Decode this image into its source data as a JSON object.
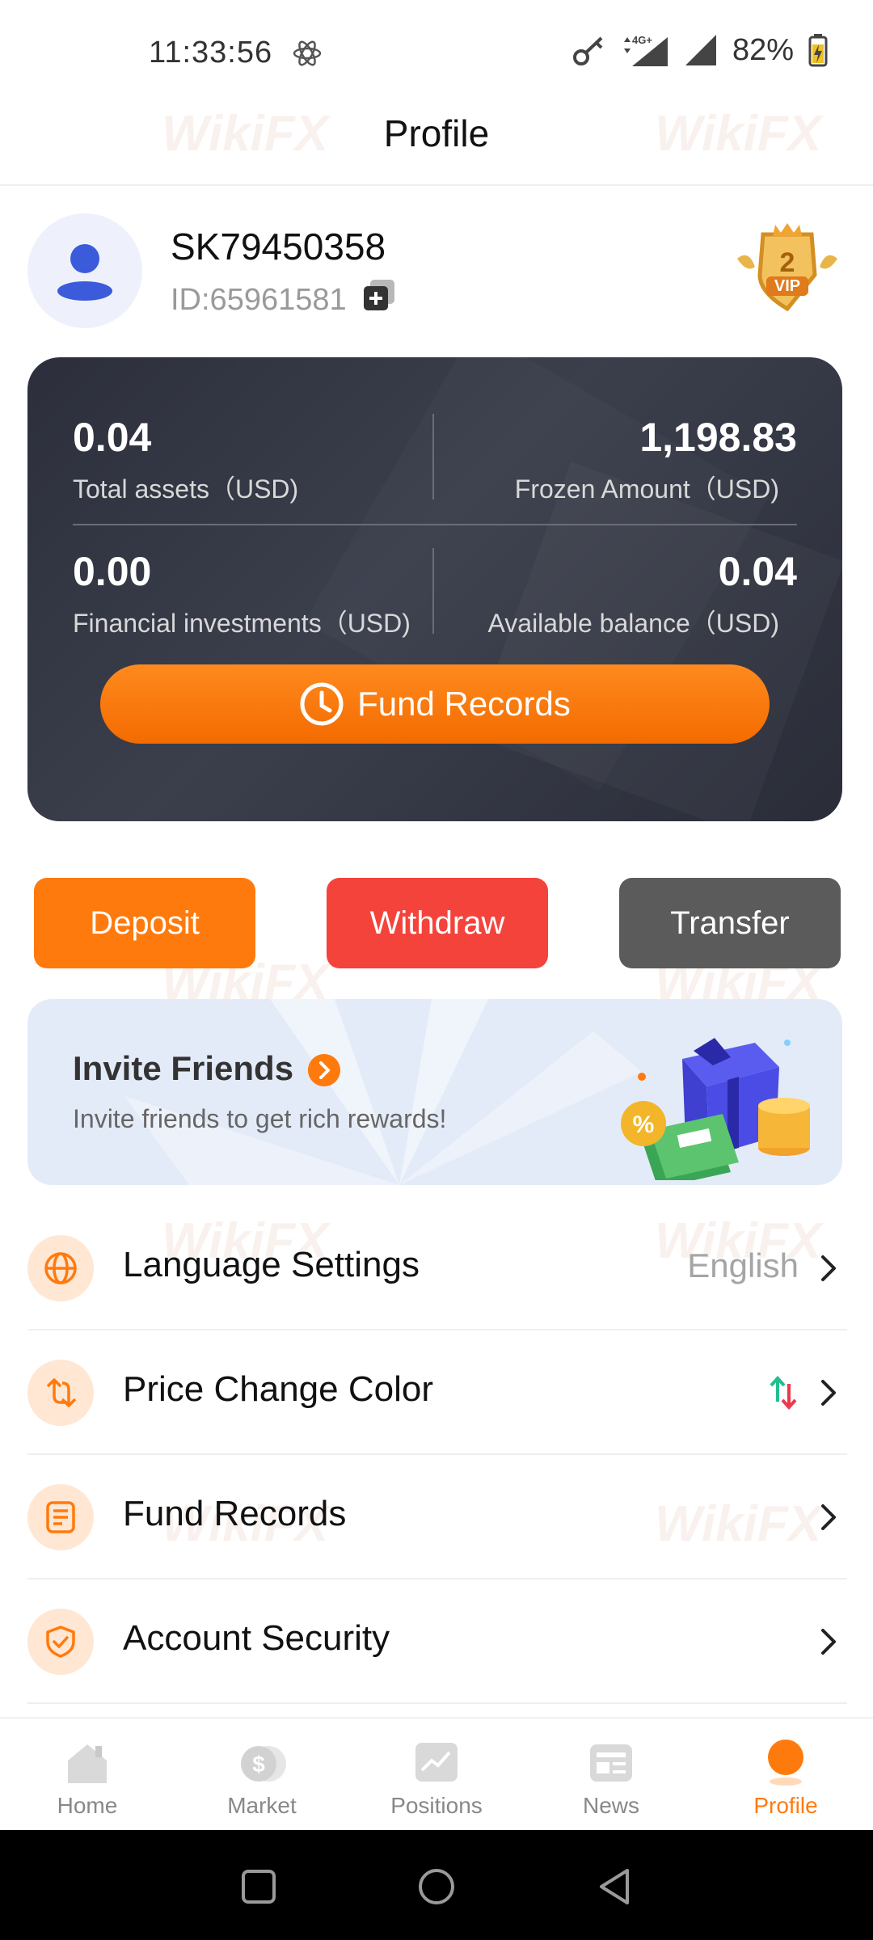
{
  "status_bar": {
    "time": "11:33:56",
    "network": "4G+",
    "battery": "82%"
  },
  "header": {
    "title": "Profile"
  },
  "user": {
    "username": "SK79450358",
    "id": "ID:65961581",
    "vip_level": "2",
    "vip_text": "VIP"
  },
  "assets": {
    "total_value": "0.04",
    "total_label": "Total assets（USD)",
    "frozen_value": "1,198.83",
    "frozen_label": "Frozen Amount（USD)",
    "financial_value": "0.00",
    "financial_label": "Financial investments（USD)",
    "available_value": "0.04",
    "available_label": "Available balance（USD)",
    "fund_records_button": "Fund Records"
  },
  "actions": {
    "deposit": "Deposit",
    "withdraw": "Withdraw",
    "transfer": "Transfer"
  },
  "invite": {
    "title": "Invite Friends",
    "subtitle": "Invite friends to get rich rewards!"
  },
  "menu": [
    {
      "label": "Language Settings",
      "value": "English",
      "icon": "globe-icon"
    },
    {
      "label": "Price Change Color",
      "value": "",
      "icon": "swap-icon"
    },
    {
      "label": "Fund Records",
      "value": "",
      "icon": "document-icon"
    },
    {
      "label": "Account Security",
      "value": "",
      "icon": "shield-check-icon"
    }
  ],
  "tabs": [
    {
      "label": "Home"
    },
    {
      "label": "Market"
    },
    {
      "label": "Positions"
    },
    {
      "label": "News"
    },
    {
      "label": "Profile"
    }
  ],
  "colors": {
    "accent": "#ff7a0d",
    "withdraw": "#f4433b",
    "transfer": "#5b5b5b",
    "card_bg": "#2f323e"
  }
}
